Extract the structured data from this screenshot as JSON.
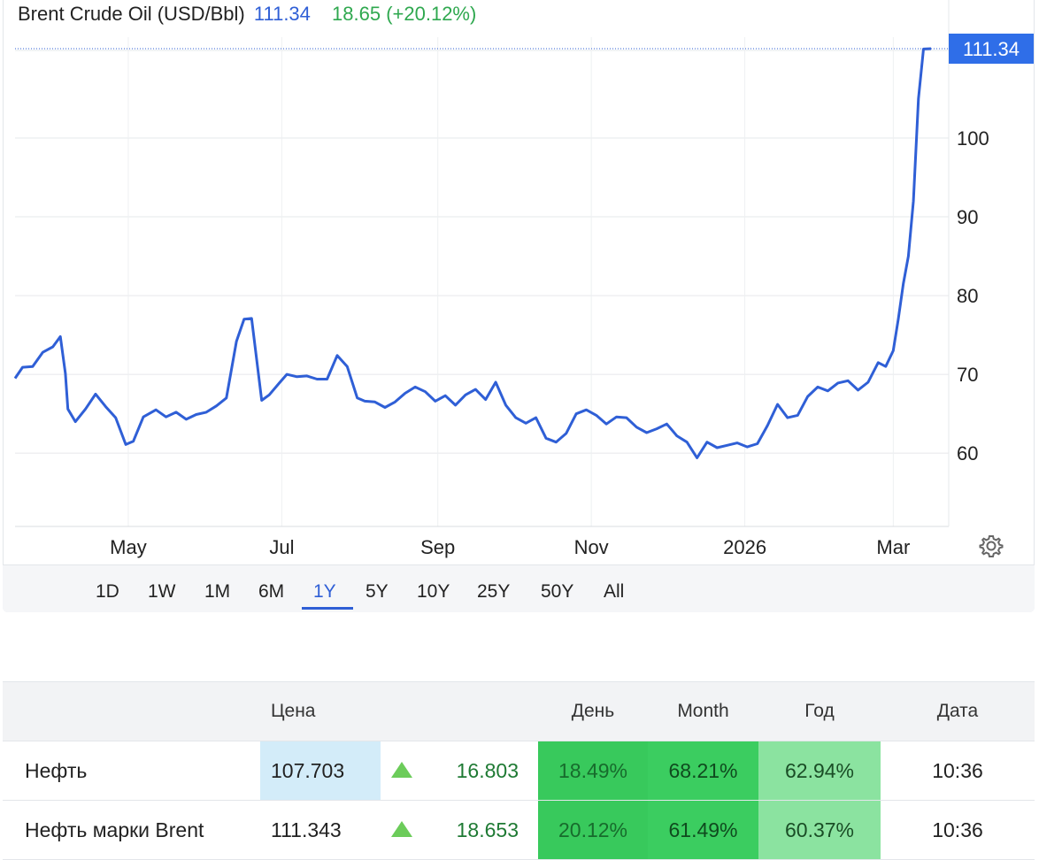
{
  "chart_data": {
    "type": "line",
    "title": "Brent Crude Oil (USD/Bbl)",
    "last_price": "111.34",
    "change": "18.65 (+20.12%)",
    "price_tag": "111.34",
    "y_ticks": [
      60,
      70,
      80,
      90,
      100
    ],
    "ylim": [
      50.7,
      112.8
    ],
    "x_ticks": [
      "May",
      "Jul",
      "Sep",
      "Nov",
      "2026",
      "Mar"
    ],
    "x_range": [
      "2025-03-17",
      "2026-03-16"
    ],
    "grid": true,
    "series": [
      {
        "x": [
          "2025-03-17",
          "2025-03-20",
          "2025-03-24",
          "2025-03-28",
          "2025-04-01",
          "2025-04-04",
          "2025-04-06",
          "2025-04-07",
          "2025-04-10",
          "2025-04-14",
          "2025-04-18",
          "2025-04-22",
          "2025-04-26",
          "2025-04-30",
          "2025-05-03",
          "2025-05-07",
          "2025-05-12",
          "2025-05-16",
          "2025-05-20",
          "2025-05-24",
          "2025-05-28",
          "2025-06-01",
          "2025-06-05",
          "2025-06-09",
          "2025-06-13",
          "2025-06-16",
          "2025-06-19",
          "2025-06-23",
          "2025-06-26",
          "2025-06-30",
          "2025-07-03",
          "2025-07-07",
          "2025-07-11",
          "2025-07-15",
          "2025-07-19",
          "2025-07-23",
          "2025-07-27",
          "2025-07-31",
          "2025-08-03",
          "2025-08-07",
          "2025-08-11",
          "2025-08-15",
          "2025-08-19",
          "2025-08-23",
          "2025-08-27",
          "2025-08-31",
          "2025-09-04",
          "2025-09-08",
          "2025-09-12",
          "2025-09-16",
          "2025-09-20",
          "2025-09-24",
          "2025-09-28",
          "2025-10-02",
          "2025-10-06",
          "2025-10-10",
          "2025-10-14",
          "2025-10-18",
          "2025-10-22",
          "2025-10-26",
          "2025-10-30",
          "2025-11-03",
          "2025-11-07",
          "2025-11-11",
          "2025-11-15",
          "2025-11-19",
          "2025-11-23",
          "2025-11-27",
          "2025-12-01",
          "2025-12-05",
          "2025-12-09",
          "2025-12-13",
          "2025-12-17",
          "2025-12-21",
          "2025-12-25",
          "2025-12-29",
          "2026-01-02",
          "2026-01-06",
          "2026-01-10",
          "2026-01-14",
          "2026-01-18",
          "2026-01-22",
          "2026-01-26",
          "2026-01-30",
          "2026-02-03",
          "2026-02-07",
          "2026-02-11",
          "2026-02-15",
          "2026-02-19",
          "2026-02-23",
          "2026-02-26",
          "2026-03-01",
          "2026-03-03",
          "2026-03-05",
          "2026-03-07",
          "2026-03-09",
          "2026-03-11",
          "2026-03-13",
          "2026-03-16"
        ],
        "values": [
          69.5,
          70.9,
          71.0,
          72.8,
          73.5,
          74.8,
          70.1,
          65.6,
          64.0,
          65.6,
          67.5,
          65.9,
          64.5,
          61.1,
          61.5,
          64.6,
          65.5,
          64.6,
          65.2,
          64.3,
          64.9,
          65.2,
          66.0,
          67.0,
          74.2,
          77.0,
          77.1,
          66.7,
          67.4,
          68.9,
          70.0,
          69.7,
          69.8,
          69.4,
          69.4,
          72.4,
          71.0,
          67.0,
          66.6,
          66.5,
          65.8,
          66.5,
          67.6,
          68.4,
          67.8,
          66.6,
          67.3,
          66.1,
          67.4,
          68.1,
          66.8,
          69.0,
          66.1,
          64.5,
          63.8,
          64.5,
          61.9,
          61.4,
          62.5,
          65.0,
          65.5,
          64.8,
          63.7,
          64.6,
          64.5,
          63.3,
          62.6,
          63.1,
          63.7,
          62.2,
          61.4,
          59.4,
          61.4,
          60.7,
          61.0,
          61.3,
          60.8,
          61.2,
          63.5,
          66.2,
          64.5,
          64.8,
          67.2,
          68.4,
          67.9,
          68.9,
          69.2,
          68.0,
          69.0,
          71.5,
          71.0,
          73.0,
          77.0,
          81.5,
          85.0,
          92.0,
          105.0,
          111.3,
          111.34
        ]
      }
    ]
  },
  "ranges": {
    "options": [
      "1D",
      "1W",
      "1M",
      "6M",
      "1Y",
      "5Y",
      "10Y",
      "25Y",
      "50Y",
      "All"
    ],
    "active": "1Y"
  },
  "table": {
    "headers": {
      "price": "Цена",
      "day": "День",
      "month": "Month",
      "year": "Год",
      "date": "Дата"
    },
    "rows": [
      {
        "name": "Нефть",
        "price": "107.703",
        "change": "16.803",
        "day": "18.49%",
        "month": "68.21%",
        "year": "62.94%",
        "time": "10:36"
      },
      {
        "name": "Нефть марки Brent",
        "price": "111.343",
        "change": "18.653",
        "day": "20.12%",
        "month": "61.49%",
        "year": "60.37%",
        "time": "10:36"
      }
    ]
  },
  "colors": {
    "line": "#2f5fd6",
    "price_highlight": "#d3ecf9",
    "up_arrow": "#6ccc5a",
    "day_cell": "#38c95c",
    "month_cell": "#3bcd60",
    "year_cell": "#8be3a0"
  },
  "icons": {
    "settings": "gear-icon",
    "up": "triangle-up-icon"
  }
}
